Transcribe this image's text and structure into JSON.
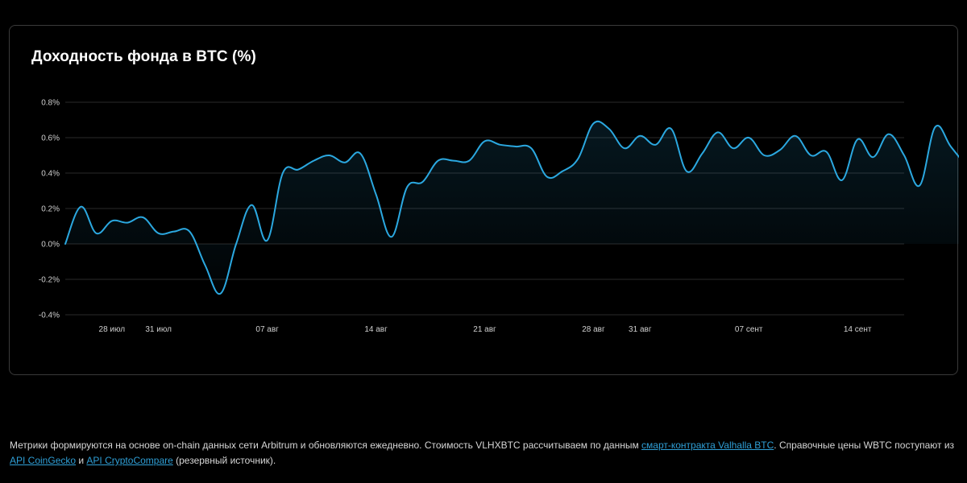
{
  "chart": {
    "title": "Доходность фонда в BTC (%)"
  },
  "colors": {
    "background": "#000000",
    "line": "#2ba8e0",
    "grid": "#2a2a2a",
    "card_border": "#3a3a3a",
    "link": "#2f9fd6"
  },
  "chart_data": {
    "type": "area",
    "title": "Доходность фонда в BTC (%)",
    "xlabel": "",
    "ylabel": "",
    "grid": true,
    "legend": "none",
    "ylim": [
      -0.4,
      0.8
    ],
    "xlim": [
      "2025-07-25",
      "2025-09-17"
    ],
    "y_ticks": [
      -0.4,
      -0.2,
      0.0,
      0.2,
      0.4,
      0.6,
      0.8
    ],
    "y_tick_labels": [
      "-0.4%",
      "-0.2%",
      "0.0%",
      "0.2%",
      "0.4%",
      "0.6%",
      "0.8%"
    ],
    "x_ticks": [
      {
        "date": "2025-07-28",
        "label": "28 июл"
      },
      {
        "date": "2025-07-31",
        "label": "31 июл"
      },
      {
        "date": "2025-08-07",
        "label": "07 авг"
      },
      {
        "date": "2025-08-14",
        "label": "14 авг"
      },
      {
        "date": "2025-08-21",
        "label": "21 авг"
      },
      {
        "date": "2025-08-28",
        "label": "28 авг"
      },
      {
        "date": "2025-08-31",
        "label": "31 авг"
      },
      {
        "date": "2025-09-07",
        "label": "07 сент"
      },
      {
        "date": "2025-09-14",
        "label": "14 сент"
      }
    ],
    "series": [
      {
        "values": [
          [
            "2025-07-25",
            0.0
          ],
          [
            "2025-07-26",
            0.21
          ],
          [
            "2025-07-27",
            0.06
          ],
          [
            "2025-07-28",
            0.13
          ],
          [
            "2025-07-29",
            0.12
          ],
          [
            "2025-07-30",
            0.15
          ],
          [
            "2025-07-31",
            0.06
          ],
          [
            "2025-08-01",
            0.07
          ],
          [
            "2025-08-02",
            0.07
          ],
          [
            "2025-08-03",
            -0.12
          ],
          [
            "2025-08-04",
            -0.28
          ],
          [
            "2025-08-05",
            0.0
          ],
          [
            "2025-08-06",
            0.22
          ],
          [
            "2025-08-07",
            0.02
          ],
          [
            "2025-08-08",
            0.4
          ],
          [
            "2025-08-09",
            0.42
          ],
          [
            "2025-08-10",
            0.47
          ],
          [
            "2025-08-11",
            0.5
          ],
          [
            "2025-08-12",
            0.46
          ],
          [
            "2025-08-13",
            0.51
          ],
          [
            "2025-08-14",
            0.28
          ],
          [
            "2025-08-15",
            0.04
          ],
          [
            "2025-08-16",
            0.32
          ],
          [
            "2025-08-17",
            0.35
          ],
          [
            "2025-08-18",
            0.47
          ],
          [
            "2025-08-19",
            0.47
          ],
          [
            "2025-08-20",
            0.47
          ],
          [
            "2025-08-21",
            0.58
          ],
          [
            "2025-08-22",
            0.56
          ],
          [
            "2025-08-23",
            0.55
          ],
          [
            "2025-08-24",
            0.54
          ],
          [
            "2025-08-25",
            0.38
          ],
          [
            "2025-08-26",
            0.41
          ],
          [
            "2025-08-27",
            0.48
          ],
          [
            "2025-08-28",
            0.68
          ],
          [
            "2025-08-29",
            0.65
          ],
          [
            "2025-08-30",
            0.54
          ],
          [
            "2025-08-31",
            0.61
          ],
          [
            "2025-09-01",
            0.56
          ],
          [
            "2025-09-02",
            0.65
          ],
          [
            "2025-09-03",
            0.41
          ],
          [
            "2025-09-04",
            0.51
          ],
          [
            "2025-09-05",
            0.63
          ],
          [
            "2025-09-06",
            0.54
          ],
          [
            "2025-09-07",
            0.6
          ],
          [
            "2025-09-08",
            0.5
          ],
          [
            "2025-09-09",
            0.53
          ],
          [
            "2025-09-10",
            0.61
          ],
          [
            "2025-09-11",
            0.5
          ],
          [
            "2025-09-12",
            0.52
          ],
          [
            "2025-09-13",
            0.36
          ],
          [
            "2025-09-14",
            0.59
          ],
          [
            "2025-09-15",
            0.49
          ],
          [
            "2025-09-16",
            0.62
          ],
          [
            "2025-09-17",
            0.5
          ],
          [
            "2025-09-18",
            0.33
          ],
          [
            "2025-09-19",
            0.66
          ],
          [
            "2025-09-20",
            0.55
          ],
          [
            "2025-09-21",
            0.44
          ]
        ]
      }
    ]
  },
  "footer": {
    "text_1": "Метрики формируются на основе on-chain данных сети Arbitrum и обновляются ежедневно. Стоимость VLHXBTC рассчитываем по данным ",
    "link_contract": "смарт-контракта Valhalla BTC",
    "text_2": ". Справочные цены WBTC поступают из ",
    "link_coingecko": "API CoinGecko",
    "text_3": " и ",
    "link_cryptocompare": "API CryptoCompare",
    "text_4": " (резервный источник)."
  }
}
